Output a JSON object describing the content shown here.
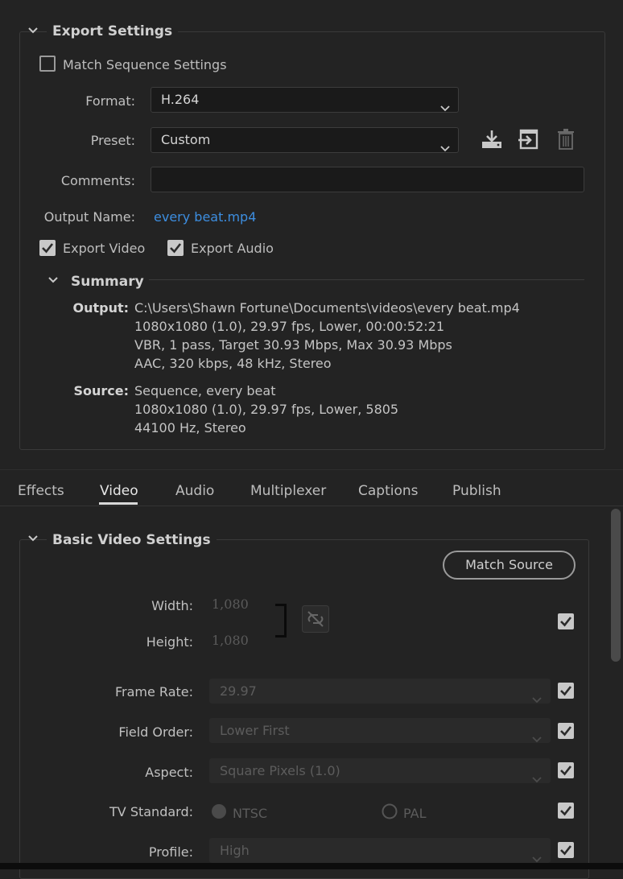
{
  "export_settings": {
    "title": "Export Settings",
    "match_sequence_label": "Match Sequence Settings",
    "format_label": "Format:",
    "format_value": "H.264",
    "preset_label": "Preset:",
    "preset_value": "Custom",
    "comments_label": "Comments:",
    "comments_value": "",
    "output_name_label": "Output Name:",
    "output_name_value": "every beat.mp4",
    "export_video_label": "Export Video",
    "export_audio_label": "Export Audio",
    "icons": [
      "save-preset-icon",
      "import-preset-icon",
      "delete-preset-icon"
    ]
  },
  "summary": {
    "title": "Summary",
    "output_label": "Output:",
    "output_lines": [
      "C:\\Users\\Shawn Fortune\\Documents\\videos\\every beat.mp4",
      "1080x1080 (1.0), 29.97 fps, Lower, 00:00:52:21",
      "VBR, 1 pass, Target 30.93 Mbps, Max 30.93 Mbps",
      "AAC, 320 kbps, 48 kHz, Stereo"
    ],
    "source_label": "Source:",
    "source_lines": [
      "Sequence, every beat",
      "1080x1080 (1.0), 29.97 fps, Lower, 5805",
      "44100 Hz, Stereo"
    ]
  },
  "tabs": [
    {
      "label": "Effects"
    },
    {
      "label": "Video"
    },
    {
      "label": "Audio"
    },
    {
      "label": "Multiplexer"
    },
    {
      "label": "Captions"
    },
    {
      "label": "Publish"
    }
  ],
  "basic_video": {
    "title": "Basic Video Settings",
    "match_source_label": "Match Source",
    "width_label": "Width:",
    "width_value": "1,080",
    "height_label": "Height:",
    "height_value": "1,080",
    "frame_rate_label": "Frame Rate:",
    "frame_rate_value": "29.97",
    "field_order_label": "Field Order:",
    "field_order_value": "Lower First",
    "aspect_label": "Aspect:",
    "aspect_value": "Square Pixels (1.0)",
    "tv_standard_label": "TV Standard:",
    "ntsc_label": "NTSC",
    "pal_label": "PAL",
    "profile_label": "Profile:",
    "profile_value": "High"
  },
  "colors": {
    "background": "#232323",
    "link": "#3d8ee0",
    "active_tab_underline": "#d8d8d8"
  }
}
